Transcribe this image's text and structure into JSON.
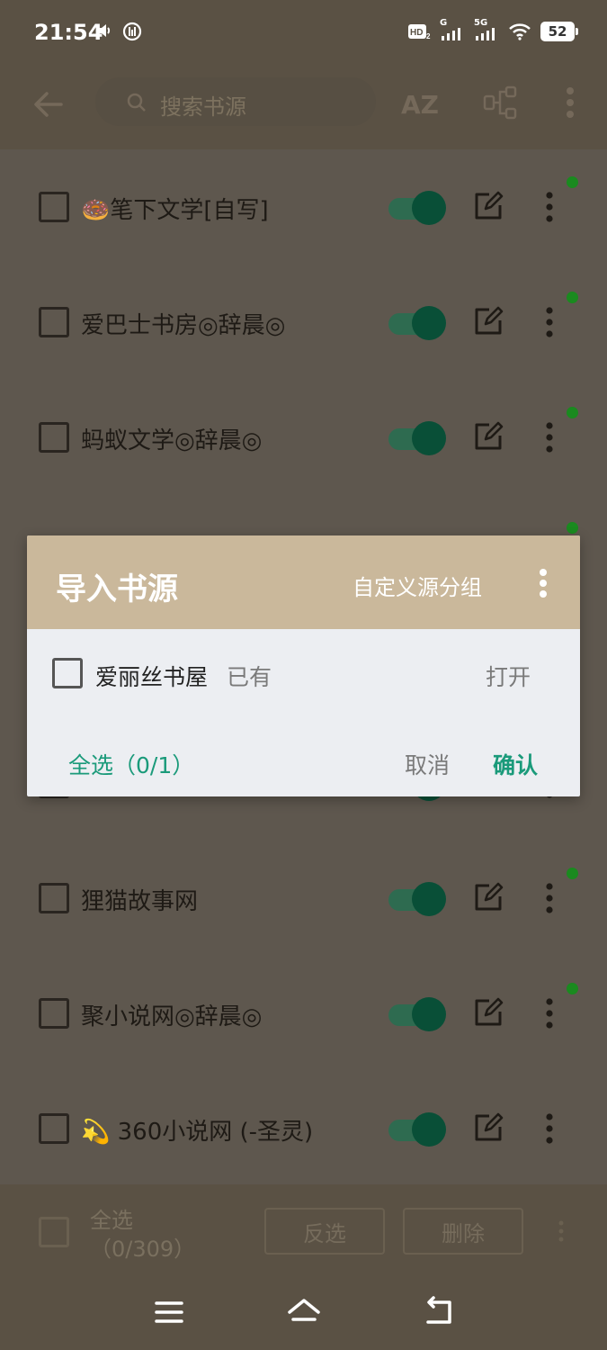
{
  "status_bar": {
    "time": "21:54",
    "network_label": "5G",
    "secondary_signal_label": "G",
    "battery": "52"
  },
  "toolbar": {
    "search_placeholder": "搜索书源",
    "sort_label": "AZ"
  },
  "list": {
    "items": [
      {
        "label": "🍩笔下文学[自写]",
        "enabled": true,
        "has_status_dot": true
      },
      {
        "label": "爱巴士书房◎辞晨◎",
        "enabled": true,
        "has_status_dot": true
      },
      {
        "label": "蚂蚁文学◎辞晨◎",
        "enabled": true,
        "has_status_dot": true
      },
      {
        "label": "",
        "enabled": true,
        "has_status_dot": true
      },
      {
        "label": "",
        "enabled": true,
        "has_status_dot": false
      },
      {
        "label": "",
        "enabled": true,
        "has_status_dot": false
      },
      {
        "label": "狸猫故事网",
        "enabled": true,
        "has_status_dot": true
      },
      {
        "label": "聚小说网◎辞晨◎",
        "enabled": true,
        "has_status_dot": true
      },
      {
        "label": "💫 360小说网 (-圣灵)",
        "enabled": true,
        "has_status_dot": false
      }
    ]
  },
  "bottom_bar": {
    "select_all_label": "全选",
    "select_count": "（0/309）",
    "invert_label": "反选",
    "delete_label": "删除"
  },
  "dialog": {
    "title": "导入书源",
    "custom_group_label": "自定义源分组",
    "item_name": "爱丽丝书屋",
    "item_status": "已有",
    "open_label": "打开",
    "select_all_label": "全选（0/1）",
    "cancel_label": "取消",
    "confirm_label": "确认"
  },
  "colors": {
    "accent": "#1a9a7a",
    "dialog_header": "#cab89b",
    "status_dot": "#1a8a1f",
    "toggle_on": "#094f37"
  }
}
